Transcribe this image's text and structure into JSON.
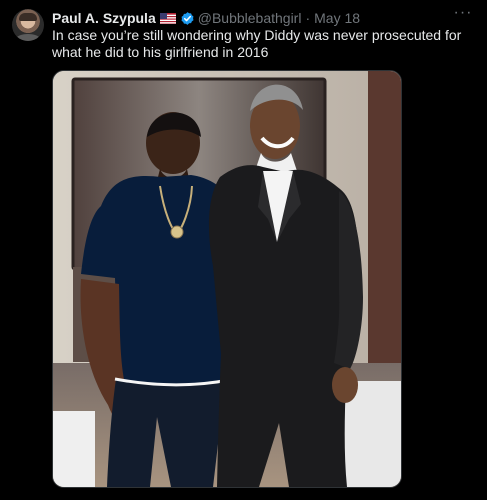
{
  "tweet": {
    "author_name": "Paul A. Szypula",
    "author_handle": "@Bubblebathgirl",
    "separator": "·",
    "date": "May 18",
    "more_label": "···",
    "text": "In case you’re still wondering why Diddy was never prosecuted for what he did to his girlfriend in 2016"
  },
  "icons": {
    "flag": "us-flag-icon",
    "verified": "verified-badge-icon",
    "more": "more-options-icon"
  },
  "colors": {
    "background": "#000000",
    "text": "#e7e9ea",
    "secondary_text": "#71767b",
    "verified_blue": "#1d9bf0"
  }
}
